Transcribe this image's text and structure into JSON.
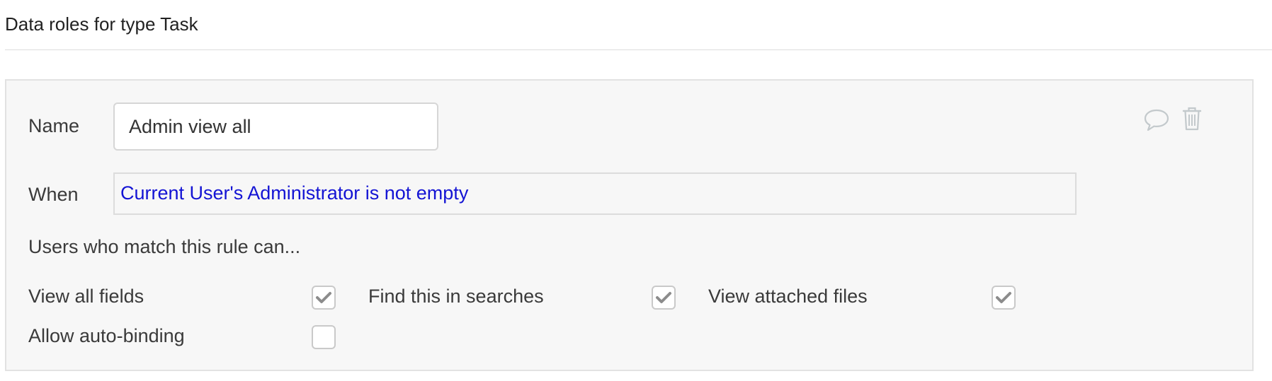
{
  "header": {
    "title": "Data roles for type Task"
  },
  "rule": {
    "name_label": "Name",
    "name_value": "Admin view all",
    "when_label": "When",
    "condition": "Current User's Administrator is not empty",
    "helper_text": "Users who match this rule can...",
    "actions": {
      "comment_icon": "speech-bubble-icon",
      "delete_icon": "trash-icon"
    },
    "permissions": [
      {
        "label": "View all fields",
        "checked": true
      },
      {
        "label": "Find this in searches",
        "checked": true
      },
      {
        "label": "View attached files",
        "checked": true
      },
      {
        "label": "Allow auto-binding",
        "checked": false
      }
    ]
  },
  "colors": {
    "condition_text": "#1414d4",
    "card_background": "#f7f7f7",
    "checkmark": "#8c8c8c"
  }
}
